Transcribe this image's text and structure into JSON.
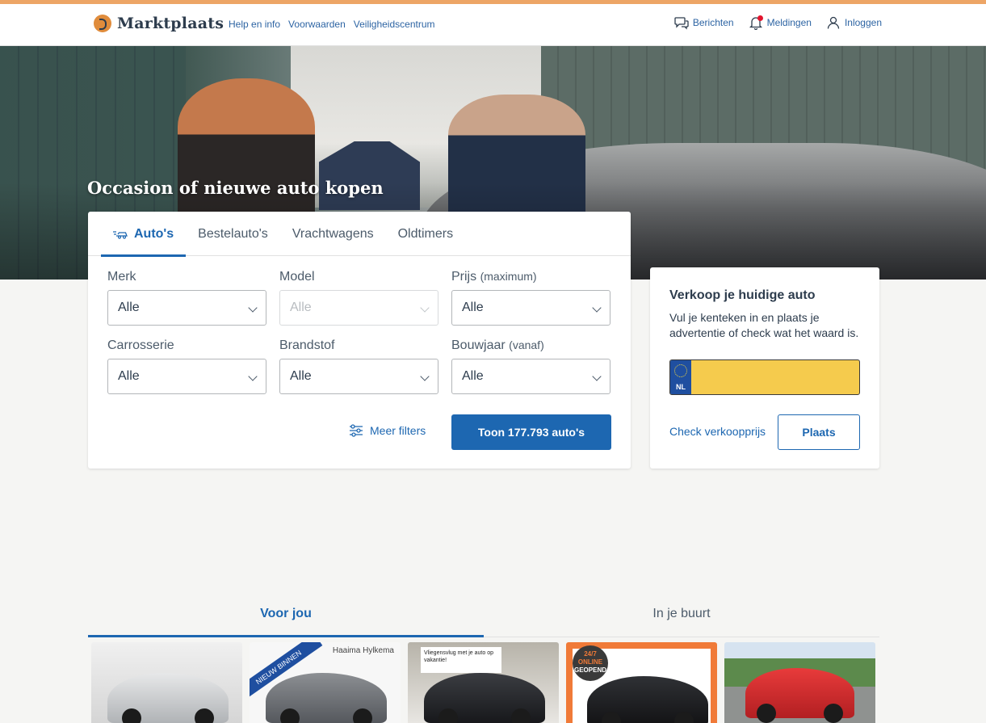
{
  "header": {
    "logo_text": "Marktplaats",
    "links": [
      "Help en info",
      "Voorwaarden",
      "Veiligheidscentrum"
    ],
    "nav": {
      "messages": "Berichten",
      "notifications": "Meldingen",
      "login": "Inloggen"
    }
  },
  "hero": {
    "title": "Occasion of nieuwe auto kopen"
  },
  "search": {
    "tabs": [
      "Auto's",
      "Bestelauto's",
      "Vrachtwagens",
      "Oldtimers"
    ],
    "active_tab": "Auto's",
    "fields": {
      "merk": {
        "label": "Merk",
        "value": "Alle"
      },
      "model": {
        "label": "Model",
        "value": "Alle",
        "disabled": true
      },
      "prijs": {
        "label": "Prijs",
        "qualifier": "(maximum)",
        "value": "Alle"
      },
      "carrosserie": {
        "label": "Carrosserie",
        "value": "Alle"
      },
      "brandstof": {
        "label": "Brandstof",
        "value": "Alle"
      },
      "bouwjaar": {
        "label": "Bouwjaar",
        "qualifier": "(vanaf)",
        "value": "Alle"
      }
    },
    "more_filters": "Meer filters",
    "submit_label": "Toon 177.793 auto's"
  },
  "sell": {
    "title": "Verkoop je huidige auto",
    "description": "Vul je kenteken in en plaats je advertentie of check wat het waard is.",
    "plate_country": "NL",
    "plate_value": "",
    "check_link": "Check verkoopprijs",
    "place_button": "Plaats"
  },
  "feed": {
    "tabs": [
      "Voor jou",
      "In je buurt"
    ],
    "active_tab": "Voor jou",
    "cards": [
      {
        "name": "silver-suv"
      },
      {
        "name": "grey-hatchback",
        "ribbon": "NIEUW BINNEN",
        "dealer": "Haaima Hylkema"
      },
      {
        "name": "black-suv",
        "promo": "Vliegensvlug met je auto op vakantie!"
      },
      {
        "name": "black-sedan",
        "badge_top": "24/7",
        "badge_mid": "ONLINE",
        "badge_bottom": "GEOPEND"
      },
      {
        "name": "red-hatchback"
      }
    ]
  },
  "colors": {
    "primary": "#1d67b1",
    "accent_stripe": "#eda566",
    "plate_yellow": "#f5cb4d",
    "plate_blue": "#1f4fa0",
    "notification_dot": "#e2142d"
  }
}
